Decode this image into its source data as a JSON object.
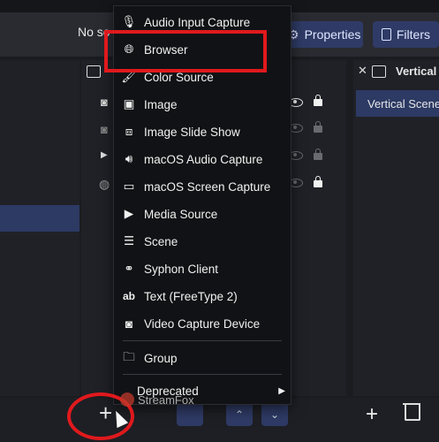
{
  "colors": {
    "accent": "#2f3b66",
    "highlight": "#e0191d"
  },
  "context_bar": {
    "no_source_text": "No so",
    "properties_label": "Properties",
    "filters_label": "Filters"
  },
  "right_dock": {
    "title": "Vertical S",
    "item": "Vertical Scene"
  },
  "menu": {
    "items": [
      {
        "label": "Audio Input Capture",
        "icon": "microphone-icon"
      },
      {
        "label": "Browser",
        "icon": "globe-icon"
      },
      {
        "label": "Color Source",
        "icon": "paint-brush-icon"
      },
      {
        "label": "Image",
        "icon": "image-icon"
      },
      {
        "label": "Image Slide Show",
        "icon": "slideshow-icon"
      },
      {
        "label": "macOS Audio Capture",
        "icon": "speaker-icon"
      },
      {
        "label": "macOS Screen Capture",
        "icon": "monitor-icon"
      },
      {
        "label": "Media Source",
        "icon": "play-icon"
      },
      {
        "label": "Scene",
        "icon": "list-icon"
      },
      {
        "label": "Syphon Client",
        "icon": "link-icon"
      },
      {
        "label": "Text (FreeType 2)",
        "icon": "text-icon"
      },
      {
        "label": "Video Capture Device",
        "icon": "camera-icon"
      },
      {
        "label": "Group",
        "icon": "folder-icon"
      },
      {
        "label": "Deprecated",
        "icon": "chevron-right-icon"
      }
    ]
  },
  "watermark": {
    "text": "StreamFox"
  }
}
